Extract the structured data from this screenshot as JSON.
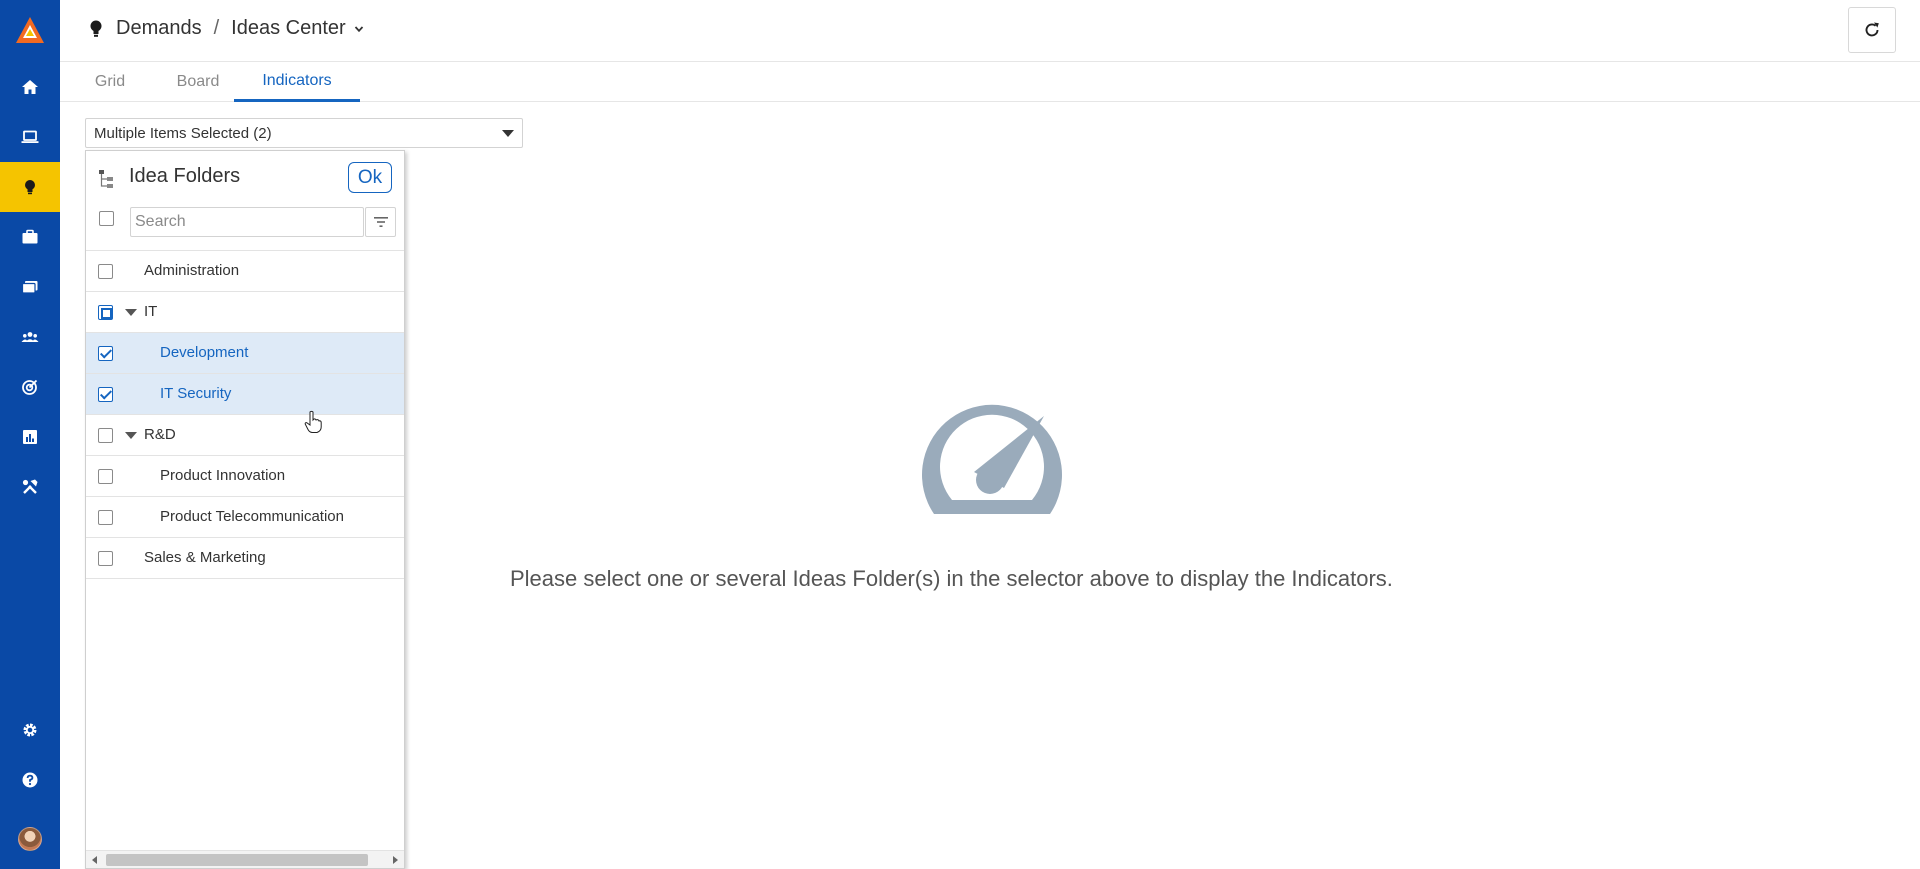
{
  "app": {
    "accent_color": "#0a49a6",
    "active_color": "#f5c400",
    "link_color": "#1565c0"
  },
  "rail": {
    "items": [
      {
        "icon": "home-icon",
        "active": false
      },
      {
        "icon": "laptop-icon",
        "active": false
      },
      {
        "icon": "lightbulb-icon",
        "active": true
      },
      {
        "icon": "briefcase-icon",
        "active": false
      },
      {
        "icon": "folders-icon",
        "active": false
      },
      {
        "icon": "team-icon",
        "active": false
      },
      {
        "icon": "target-icon",
        "active": false
      },
      {
        "icon": "bar-chart-icon",
        "active": false
      },
      {
        "icon": "tools-icon",
        "active": false
      }
    ],
    "bottom": [
      "settings-icon",
      "help-icon",
      "avatar"
    ]
  },
  "header": {
    "breadcrumb_root": "Demands",
    "separator": "/",
    "breadcrumb_current": "Ideas Center"
  },
  "tabs": [
    {
      "label": "Grid",
      "active": false
    },
    {
      "label": "Board",
      "active": false
    },
    {
      "label": "Indicators",
      "active": true
    }
  ],
  "selector": {
    "value": "Multiple Items Selected (2)"
  },
  "panel": {
    "title": "Idea Folders",
    "ok_label": "Ok",
    "search_placeholder": "Search",
    "items": [
      {
        "label": "Administration",
        "level": 0,
        "state": "unchecked",
        "expandable": false
      },
      {
        "label": "IT",
        "level": 0,
        "state": "partial",
        "expandable": true
      },
      {
        "label": "Development",
        "level": 1,
        "state": "checked",
        "expandable": false
      },
      {
        "label": "IT Security",
        "level": 1,
        "state": "checked",
        "expandable": false
      },
      {
        "label": "R&D",
        "level": 0,
        "state": "unchecked",
        "expandable": true
      },
      {
        "label": "Product Innovation",
        "level": 1,
        "state": "unchecked",
        "expandable": false
      },
      {
        "label": "Product Telecommunication",
        "level": 1,
        "state": "unchecked",
        "expandable": false
      },
      {
        "label": "Sales & Marketing",
        "level": 0,
        "state": "unchecked",
        "expandable": false
      }
    ]
  },
  "empty_state": {
    "icon": "speedometer-icon",
    "message": "Please select one or several Ideas Folder(s) in the selector above to display the Indicators."
  }
}
